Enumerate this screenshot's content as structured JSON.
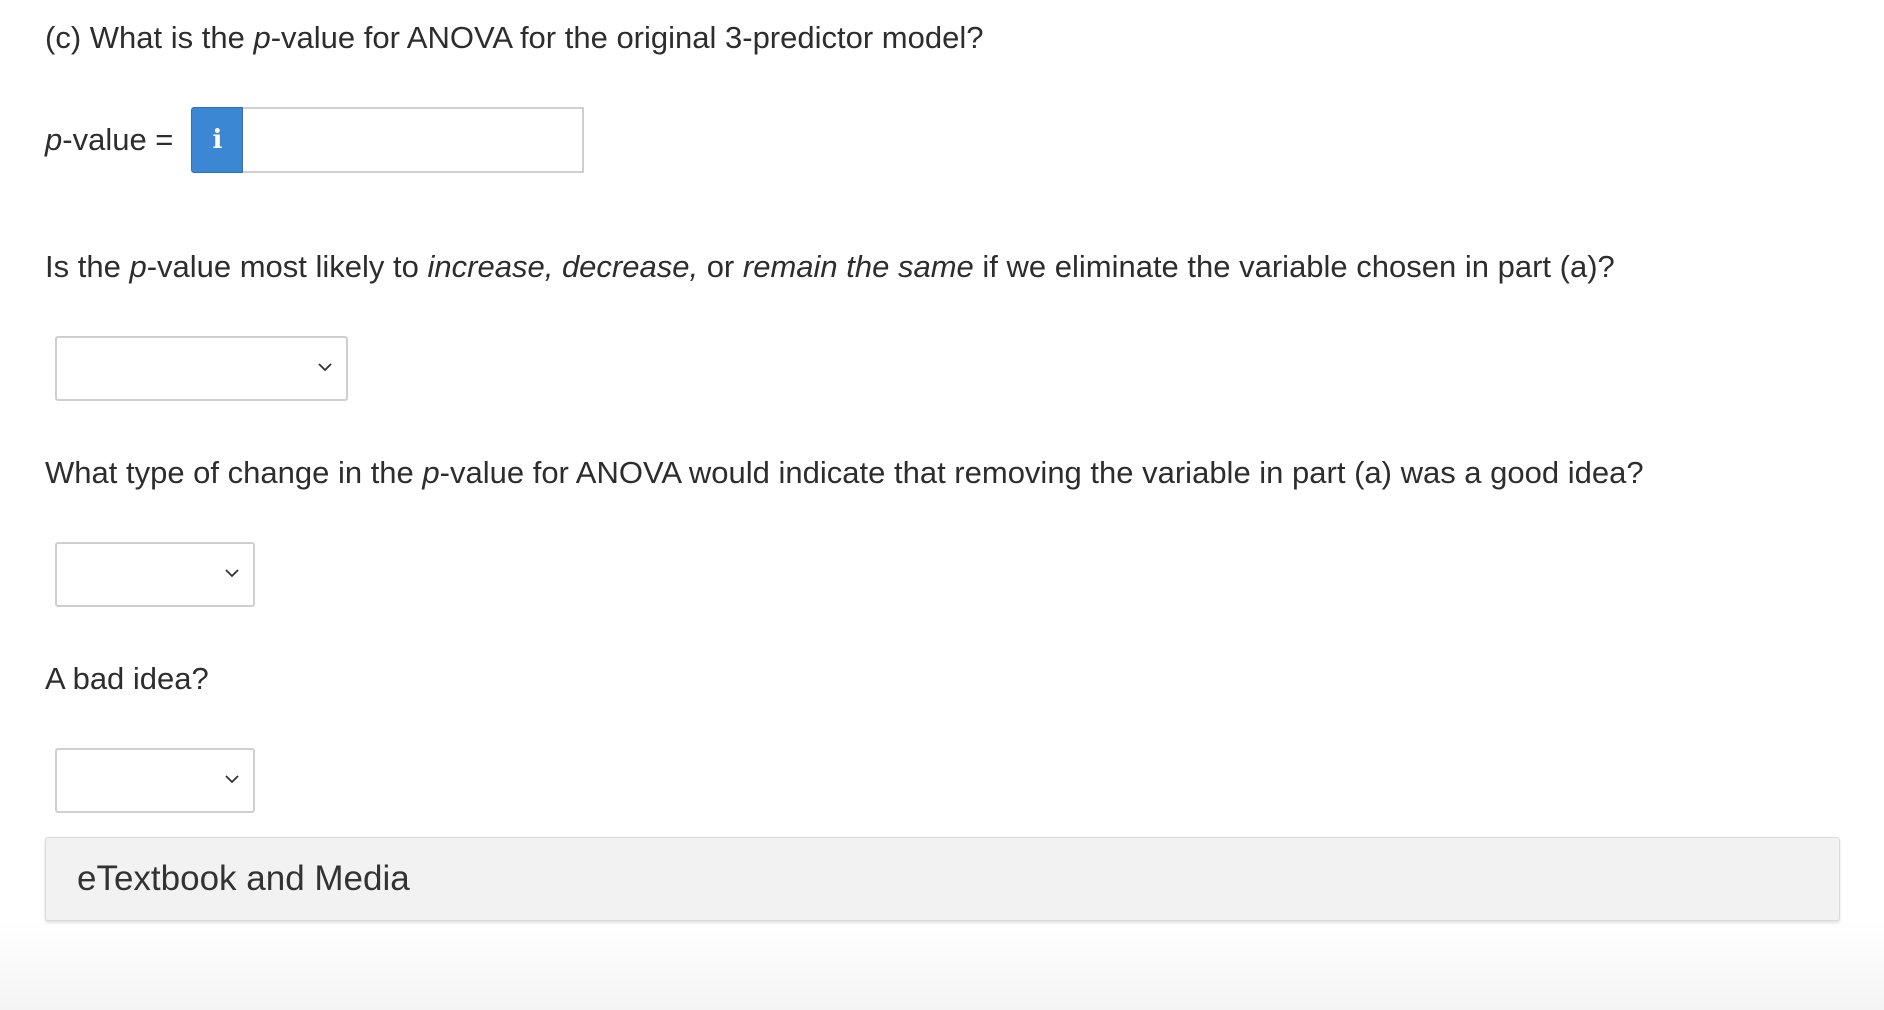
{
  "question_c": {
    "prefix": "(c) What is the ",
    "p": "p",
    "suffix": "-value for ANOVA for the original 3-predictor model?"
  },
  "pvalue_field": {
    "label_p": "p",
    "label_rest": "-value =",
    "info_glyph": "i",
    "info_icon": "info-icon",
    "value": "",
    "placeholder": ""
  },
  "question_incdec": {
    "part1": "Is the ",
    "p": "p",
    "part2": "-value most likely to ",
    "increase": "increase,",
    "part3": " ",
    "decrease": "decrease,",
    "part4": " or ",
    "remain": "remain the same",
    "part5": " if we eliminate the variable chosen in part (a)?"
  },
  "dropdown_incdec": {
    "selected": ""
  },
  "question_good": {
    "part1": "What type of change in the ",
    "p": "p",
    "part2": "-value for ANOVA would indicate that removing the variable in part (a) was a good idea?"
  },
  "dropdown_good": {
    "selected": ""
  },
  "question_bad": {
    "text": "A bad idea?"
  },
  "dropdown_bad": {
    "selected": ""
  },
  "etextbook": {
    "label": "eTextbook and Media"
  },
  "colors": {
    "info_button": "#3b87d4",
    "text": "#2d2d2d",
    "bar_background": "#f2f2f2",
    "border": "#cfcfcf"
  }
}
